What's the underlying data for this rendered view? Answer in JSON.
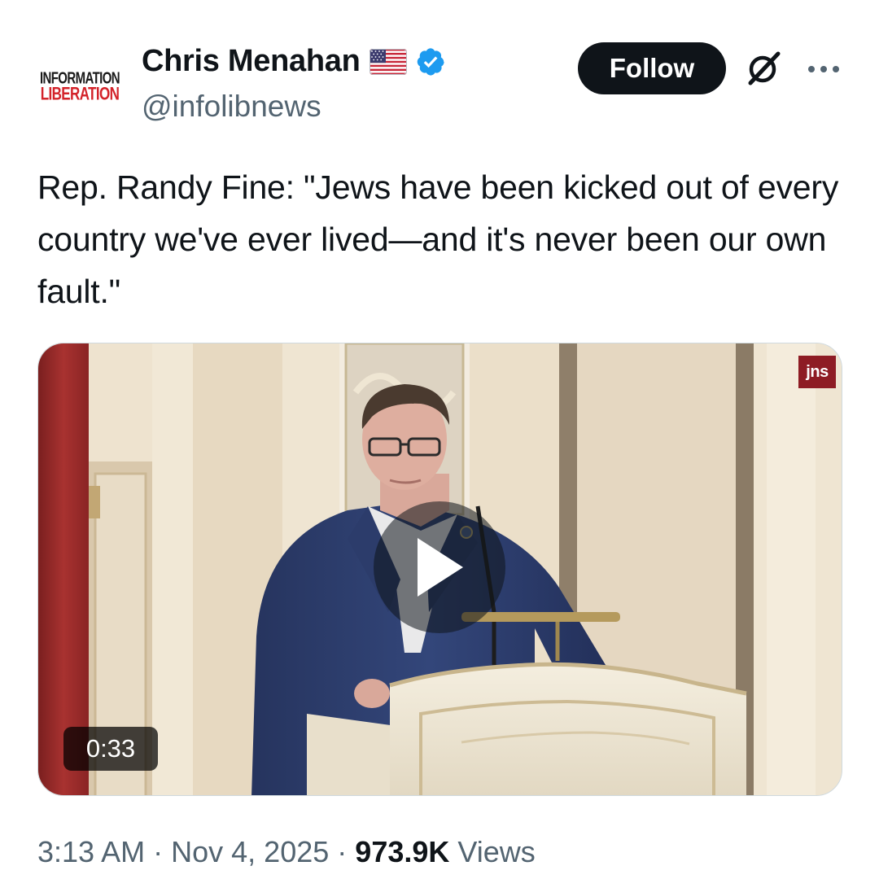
{
  "author": {
    "avatar_line1": "INFORMATION",
    "avatar_line2": "LIBERATION",
    "display_name": "Chris Menahan",
    "handle": "@infolibnews",
    "badges": [
      "us-flag-emoji",
      "verified-badge-icon"
    ]
  },
  "actions": {
    "follow_label": "Follow",
    "grok_icon": "grok-icon",
    "more_icon": "more-options-icon"
  },
  "tweet": {
    "text": "Rep. Randy Fine: \"Jews have been kicked out of every country we've ever lived—and it's never been our own fault.\""
  },
  "media": {
    "type": "video",
    "duration": "0:33",
    "watermark": "jns",
    "play_icon": "play-icon"
  },
  "meta": {
    "time": "3:13 AM",
    "separator": "·",
    "date": "Nov 4, 2025",
    "views_count": "973.9K",
    "views_label": "Views"
  },
  "colors": {
    "text_primary": "#0f1419",
    "text_secondary": "#536471",
    "verified_blue": "#1d9bf0",
    "follow_bg": "#0f1419"
  }
}
